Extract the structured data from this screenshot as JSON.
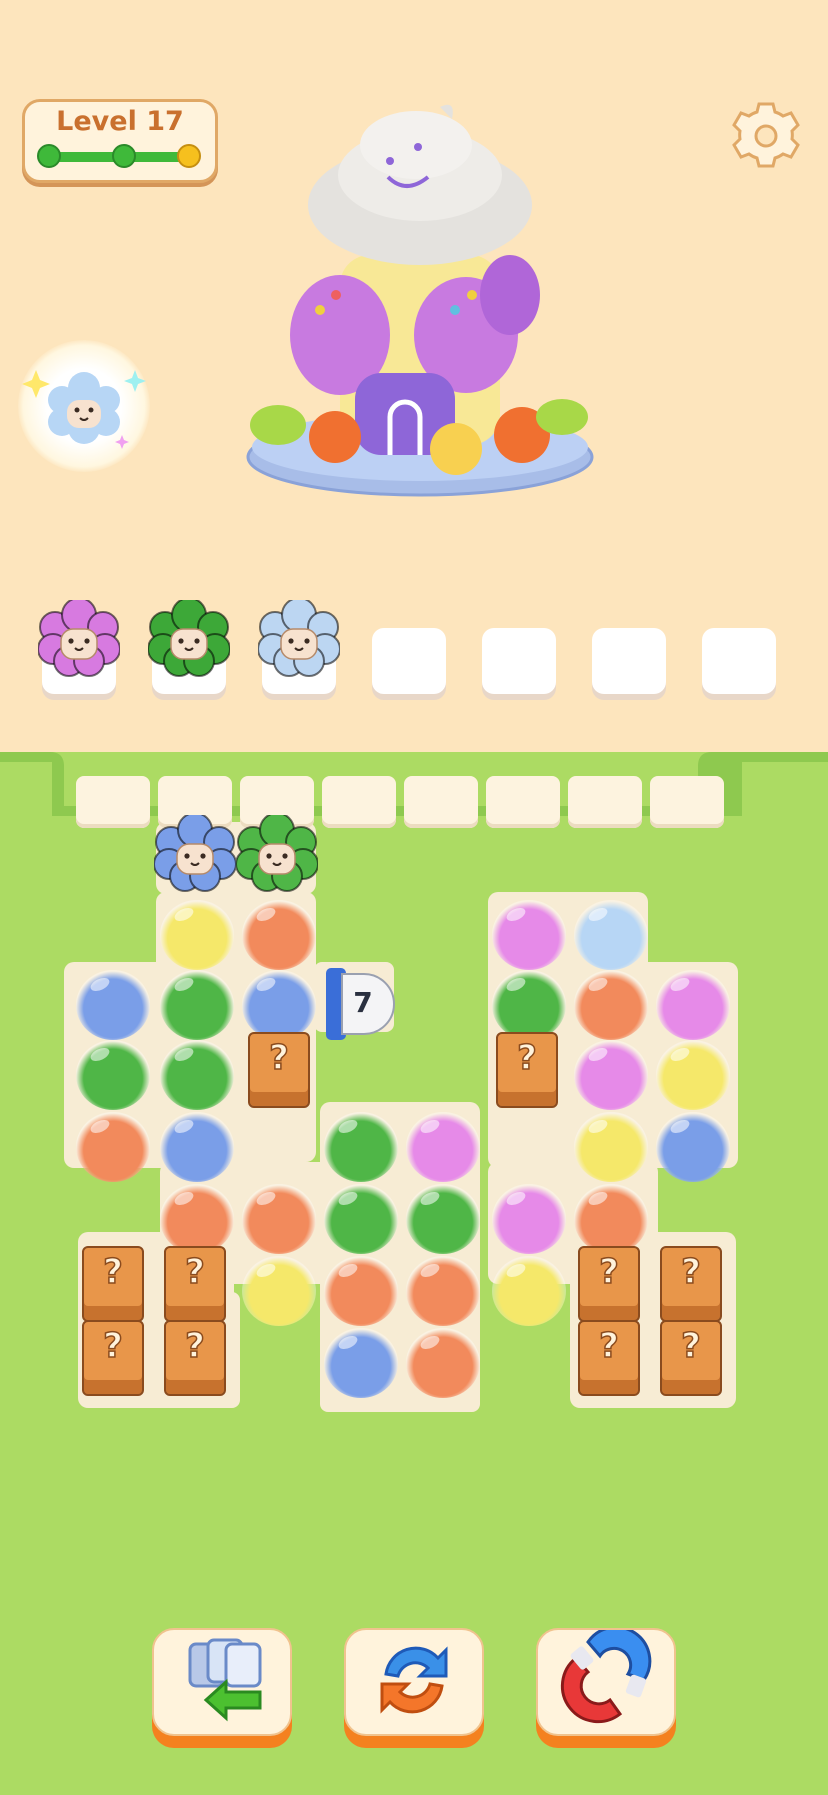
{
  "header": {
    "level_label": "Level 17",
    "progress": {
      "stages": 3,
      "current_stage": 3,
      "completed_color": "#3fb93a",
      "current_color": "#f6c01e"
    },
    "settings_icon": "gear-icon"
  },
  "bonus": {
    "icon": "sparkling-sheep-icon",
    "sheep_color": "light-blue"
  },
  "collection_slots": [
    {
      "filled": true,
      "color": "#d77ae0"
    },
    {
      "filled": true,
      "color": "#3da838"
    },
    {
      "filled": true,
      "color": "#bcd6f2"
    },
    {
      "filled": false
    },
    {
      "filled": false
    },
    {
      "filled": false
    },
    {
      "filled": false
    }
  ],
  "conveyor": {
    "slots": 8
  },
  "board": {
    "palette": {
      "blue": "#7a9ee8",
      "green": "#4fb647",
      "orange": "#f28a5c",
      "pink": "#e68ae8",
      "yellow": "#f5e86a",
      "lightblue": "#b7d6f5"
    },
    "pipe_count": "7",
    "mystery_label": "?",
    "waiting_sheep": [
      "blue",
      "green"
    ]
  },
  "tools": [
    {
      "name": "undo",
      "icon": "undo-cards-icon"
    },
    {
      "name": "shuffle",
      "icon": "shuffle-icon"
    },
    {
      "name": "magnet",
      "icon": "magnet-icon"
    }
  ]
}
